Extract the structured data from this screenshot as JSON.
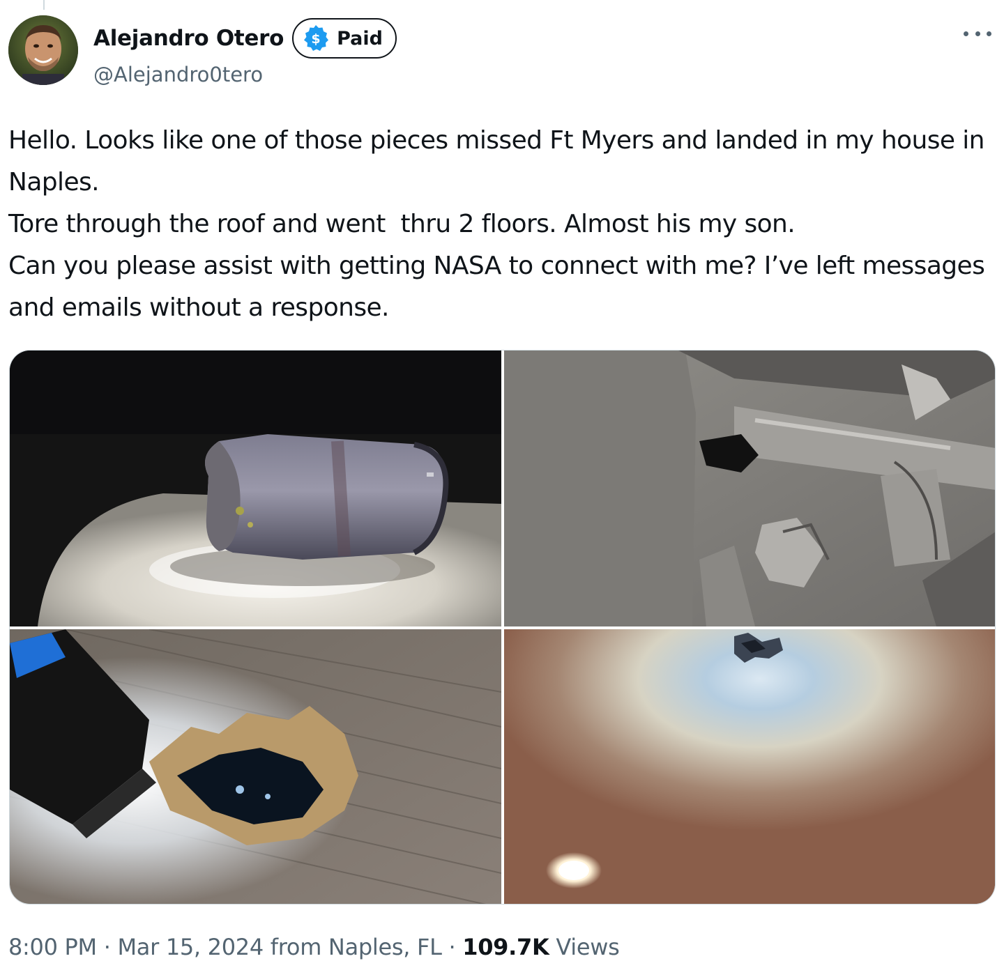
{
  "author": {
    "display_name": "Alejandro Otero",
    "handle": "@Alejandro0tero",
    "badge": {
      "label": "Paid",
      "icon": "dollar-icon",
      "icon_color": "#1d9bf0"
    },
    "avatar_icon": "avatar-photo"
  },
  "menu": {
    "icon": "more-horizontal-icon"
  },
  "tweet": {
    "lines": [
      "Hello. Looks like one of those pieces missed Ft Myers and landed in my house in Naples.",
      "Tore through the roof and went  thru 2 floors. Almost his my son.",
      "Can you please assist with getting NASA to connect with me? I’ve left messages and emails without a response."
    ]
  },
  "media": {
    "count": 4,
    "items": [
      {
        "icon": "photo-debris-cylinder"
      },
      {
        "icon": "photo-roof-damage"
      },
      {
        "icon": "photo-floor-hole"
      },
      {
        "icon": "photo-ceiling-hole"
      }
    ]
  },
  "meta": {
    "time": "8:00 PM",
    "separator": " · ",
    "date": "Mar 15, 2024",
    "location": " from Naples, FL",
    "views_count": "109.7K",
    "views_label": " Views"
  },
  "colors": {
    "text_primary": "#0f1419",
    "text_secondary": "#536471",
    "border": "#cfd9de",
    "accent": "#1d9bf0"
  }
}
